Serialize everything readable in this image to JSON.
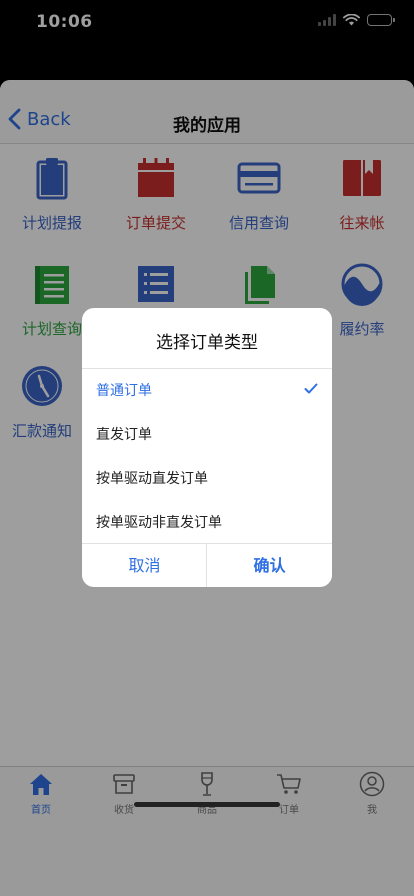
{
  "status": {
    "time": "10:06"
  },
  "nav": {
    "back_label": "Back",
    "title": "我的应用"
  },
  "apps": [
    {
      "label": "计划提报",
      "icon": "clipboard-icon",
      "color": "#3a64c8"
    },
    {
      "label": "订单提交",
      "icon": "calendar-icon",
      "color": "#c8302f"
    },
    {
      "label": "信用查询",
      "icon": "credit-card-icon",
      "color": "#3a64c8"
    },
    {
      "label": "往来帐",
      "icon": "bookmark-book-icon",
      "color": "#c8302f"
    },
    {
      "label": "计划查询",
      "icon": "notebook-icon",
      "color": "#2aa63e"
    },
    {
      "label": "",
      "icon": "list-icon",
      "color": "#3a64c8"
    },
    {
      "label": "",
      "icon": "documents-icon",
      "color": "#2aa63e"
    },
    {
      "label": "履约率",
      "icon": "wave-circle-icon",
      "color": "#3a64c8"
    },
    {
      "label": "汇款通知",
      "icon": "clock-icon",
      "color": "#3a64c8"
    }
  ],
  "tabs": [
    {
      "label": "首页",
      "icon": "home-icon"
    },
    {
      "label": "收货",
      "icon": "box-icon"
    },
    {
      "label": "商品",
      "icon": "wine-glass-icon"
    },
    {
      "label": "订单",
      "icon": "cart-icon"
    },
    {
      "label": "我",
      "icon": "user-icon"
    }
  ],
  "dialog": {
    "title": "选择订单类型",
    "options": [
      {
        "label": "普通订单",
        "selected": true
      },
      {
        "label": "直发订单",
        "selected": false
      },
      {
        "label": "按单驱动直发订单",
        "selected": false
      },
      {
        "label": "按单驱动非直发订单",
        "selected": false
      }
    ],
    "cancel_label": "取消",
    "confirm_label": "确认"
  },
  "colors": {
    "accent": "#2f6fe4",
    "red": "#c8302f",
    "green": "#2aa63e",
    "blue": "#3a64c8"
  }
}
